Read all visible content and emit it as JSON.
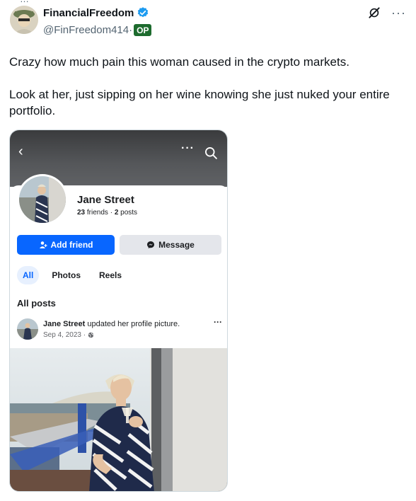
{
  "author": {
    "display_name": "FinancialFreedom",
    "handle": "@FinFreedom414",
    "handle_sep": "·",
    "op_badge": "OP",
    "verified_color": "#1d9bf0"
  },
  "tweet": {
    "paragraph_1": "Crazy how much pain this woman caused in the crypto markets.",
    "paragraph_2": "Look at her, just sipping on her wine knowing she just nuked your entire portfolio."
  },
  "screenshot": {
    "profile_name": "Jane Street",
    "friends_count": "23",
    "friends_label": " friends · ",
    "posts_count": "2",
    "posts_label": " posts",
    "add_friend_label": "Add friend",
    "message_label": "Message",
    "tabs": [
      "All",
      "Photos",
      "Reels"
    ],
    "section_title": "All posts",
    "post_author": "Jane Street",
    "post_action": " updated her profile picture.",
    "post_date": "Sep 4, 2023 ·",
    "accent_color": "#0866ff"
  }
}
